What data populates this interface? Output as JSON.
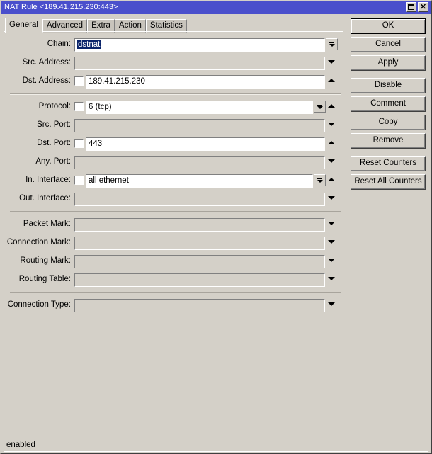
{
  "window": {
    "title": "NAT Rule <189.41.215.230:443>",
    "maximize_icon": "maximize-icon",
    "close_icon": "close-icon",
    "close_glyph": "✕"
  },
  "tabs": [
    {
      "label": "General",
      "active": true
    },
    {
      "label": "Advanced",
      "active": false
    },
    {
      "label": "Extra",
      "active": false
    },
    {
      "label": "Action",
      "active": false
    },
    {
      "label": "Statistics",
      "active": false
    }
  ],
  "fields": {
    "chain": {
      "label": "Chain:",
      "value": "dstnat"
    },
    "src_address": {
      "label": "Src. Address:",
      "value": ""
    },
    "dst_address": {
      "label": "Dst. Address:",
      "value": "189.41.215.230"
    },
    "protocol": {
      "label": "Protocol:",
      "value": "6 (tcp)"
    },
    "src_port": {
      "label": "Src. Port:",
      "value": ""
    },
    "dst_port": {
      "label": "Dst. Port:",
      "value": "443"
    },
    "any_port": {
      "label": "Any. Port:",
      "value": ""
    },
    "in_interface": {
      "label": "In. Interface:",
      "value": "all ethernet"
    },
    "out_interface": {
      "label": "Out. Interface:",
      "value": ""
    },
    "packet_mark": {
      "label": "Packet Mark:",
      "value": ""
    },
    "connection_mark": {
      "label": "Connection Mark:",
      "value": ""
    },
    "routing_mark": {
      "label": "Routing Mark:",
      "value": ""
    },
    "routing_table": {
      "label": "Routing Table:",
      "value": ""
    },
    "connection_type": {
      "label": "Connection Type:",
      "value": ""
    }
  },
  "buttons": {
    "ok": "OK",
    "cancel": "Cancel",
    "apply": "Apply",
    "disable": "Disable",
    "comment": "Comment",
    "copy": "Copy",
    "remove": "Remove",
    "reset_counters": "Reset Counters",
    "reset_all_counters": "Reset All Counters"
  },
  "status": {
    "text": "enabled"
  }
}
